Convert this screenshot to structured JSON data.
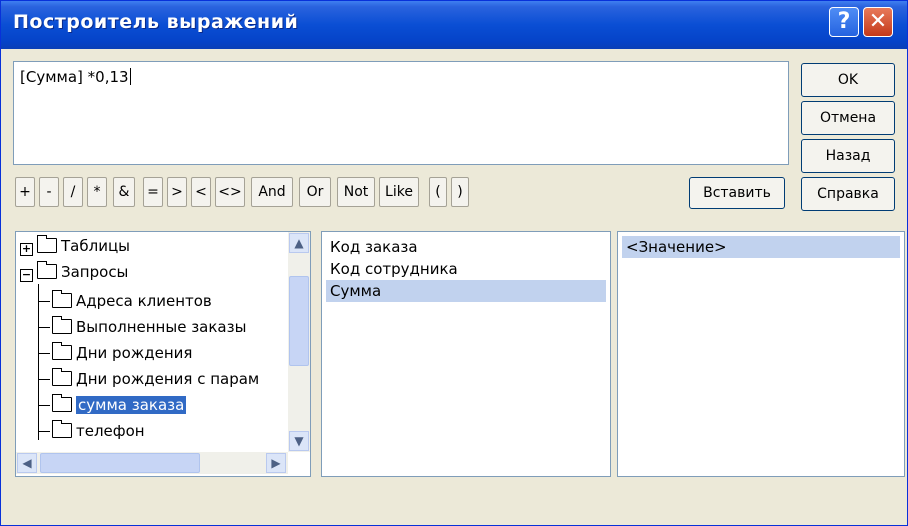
{
  "window": {
    "title": "Построитель выражений",
    "help_glyph": "?",
    "close_glyph": "✕"
  },
  "expression": {
    "value": "[Сумма] *0,13"
  },
  "buttons": {
    "ok": "OK",
    "cancel": "Отмена",
    "back": "Назад",
    "help": "Справка",
    "insert": "Вставить"
  },
  "operators": [
    "+",
    "-",
    "/",
    "*",
    "&",
    "=",
    ">",
    "<",
    "<>",
    "And",
    "Or",
    "Not",
    "Like",
    "(",
    ")"
  ],
  "tree": {
    "tables": "Таблицы",
    "queries": "Запросы",
    "items": [
      "Адреса клиентов",
      "Выполненные заказы",
      "Дни рождения",
      "Дни рождения с парам",
      "сумма заказа",
      "телефон"
    ],
    "selected_index": 4,
    "expander_plus": "+",
    "expander_minus": "−"
  },
  "fields": {
    "items": [
      "Код заказа",
      "Код сотрудника",
      "Сумма"
    ],
    "selected_index": 2
  },
  "values": {
    "items": [
      "<Значение>"
    ],
    "selected_index": 0
  },
  "scroll_arrows": {
    "up": "▲",
    "down": "▼",
    "left": "◀",
    "right": "▶"
  },
  "colors": {
    "selection": "#316ac5",
    "inactive_selection": "#c1d2ee",
    "titlebar": "#0a4ed4"
  }
}
